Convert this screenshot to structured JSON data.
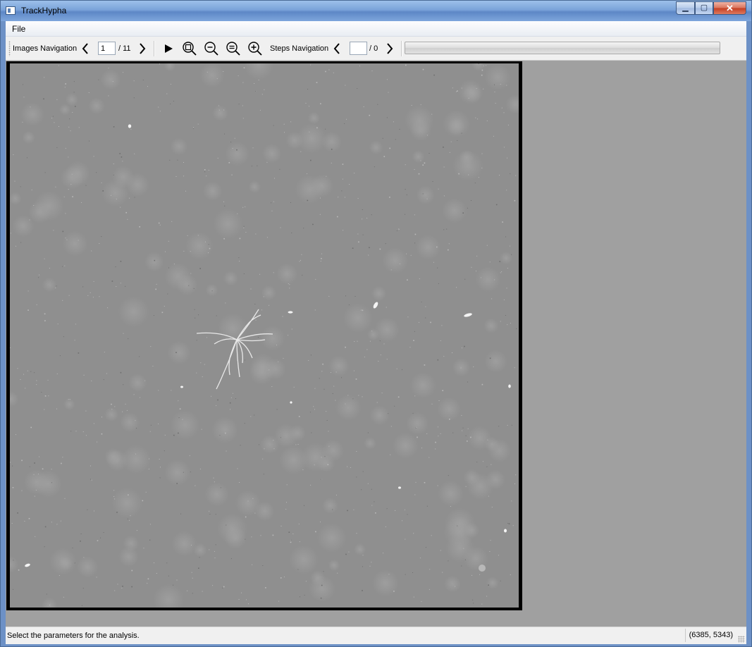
{
  "window": {
    "title": "TrackHypha"
  },
  "menu": {
    "file": "File"
  },
  "toolbar": {
    "images_label": "Images Navigation",
    "image_current": "1",
    "image_total": "/ 11",
    "steps_label": "Steps Navigation",
    "step_current": "",
    "step_total": "/ 0",
    "progress_value": 0
  },
  "icons": {
    "prev": "chevron-left-icon",
    "next": "chevron-right-icon",
    "play": "play-icon",
    "zoom_fit": "zoom-fit-icon",
    "zoom_out": "zoom-out-icon",
    "zoom_reset": "zoom-reset-icon",
    "zoom_in": "zoom-in-icon"
  },
  "status": {
    "message": "Select the parameters for the analysis.",
    "coordinates": "(6385, 5343)"
  },
  "colors": {
    "viewport_bg": "#a0a0a0",
    "progress_fill": "#4db34d"
  }
}
